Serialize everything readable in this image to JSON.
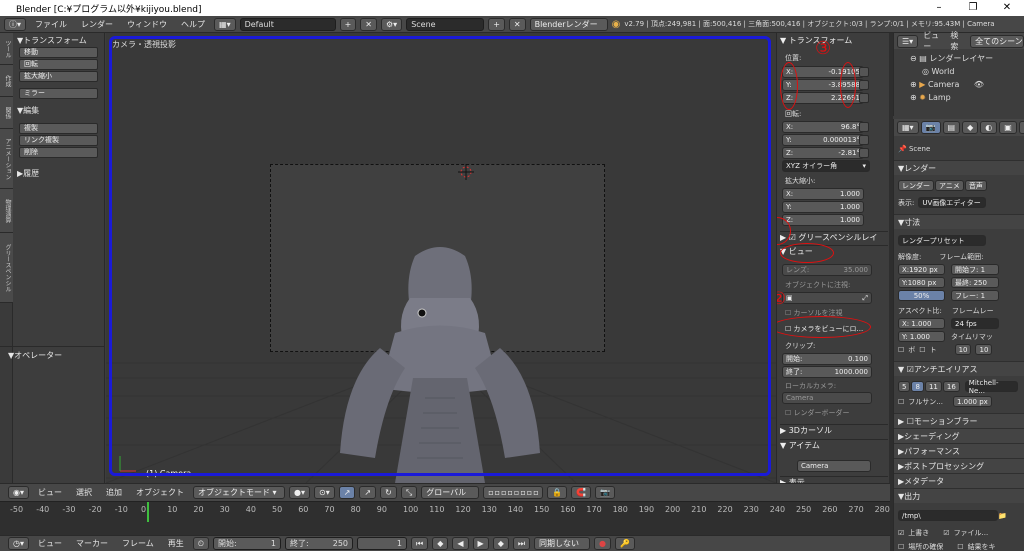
{
  "window": {
    "title": "Blender [C:¥プログラム以外¥kijiyou.blend]"
  },
  "info": {
    "menu": [
      "ファイル",
      "レンダー",
      "ウィンドウ",
      "ヘルプ"
    ],
    "layout": "Default",
    "scene": "Scene",
    "engine": "Blenderレンダー",
    "stats": "v2.79 | 頂点:249,981 | 面:500,416 | 三角面:500,416 | オブジェクト:0/3 | ランプ:0/1 | メモリ:95.43M | Camera"
  },
  "tabs": [
    "ツール",
    "作成",
    "関係",
    "アニメーション",
    "物理演算",
    "グリースペンシル"
  ],
  "toolshelf": {
    "transform_title": "トランスフォーム",
    "transform_buttons": [
      "移動",
      "回転",
      "拡大縮小"
    ],
    "mirror": "ミラー",
    "edit_title": "編集",
    "edit_buttons": [
      "複製",
      "リンク複製",
      "削除"
    ],
    "history": "履歴",
    "operator": "オペレーター"
  },
  "viewport": {
    "view_label": "カメラ・透視投影",
    "object_label": "(1) Camera"
  },
  "npanel": {
    "transform": "トランスフォーム",
    "location_label": "位置:",
    "location": [
      {
        "axis": "X:",
        "value": "-0.19105"
      },
      {
        "axis": "Y:",
        "value": "-3.89588"
      },
      {
        "axis": "Z:",
        "value": "2.22691"
      }
    ],
    "rotation_label": "回転:",
    "rotation": [
      {
        "axis": "X:",
        "value": "96.8°"
      },
      {
        "axis": "Y:",
        "value": "0.000013°"
      },
      {
        "axis": "Z:",
        "value": "-2.81°"
      }
    ],
    "rotation_mode": "XYZ オイラー角",
    "scale_label": "拡大縮小:",
    "scale": [
      {
        "axis": "X:",
        "value": "1.000"
      },
      {
        "axis": "Y:",
        "value": "1.000"
      },
      {
        "axis": "Z:",
        "value": "1.000"
      }
    ],
    "grease": "グリースペンシルレイ",
    "view": "ビュー",
    "lens_label": "レンズ:",
    "lens": "35.000",
    "lock_to_object": "オブジェクトに注視:",
    "lock_cursor": "カーソルを注視",
    "lock_camera": "カメラをビューにロ...",
    "clip": "クリップ:",
    "clip_start_label": "開始:",
    "clip_start": "0.100",
    "clip_end_label": "終了:",
    "clip_end": "1000.000",
    "local_camera": "ローカルカメラ:",
    "camera_field": "Camera",
    "render_border": "レンダーボーダー",
    "cursor3d": "3Dカーソル",
    "item": "アイテム",
    "item_name": "Camera",
    "next": "表示",
    "annot": [
      "③",
      "②",
      "①"
    ]
  },
  "outliner": {
    "view": "ビュー",
    "search": "検索",
    "all_scenes": "全てのシーン",
    "items": [
      "レンダーレイヤー",
      "World",
      "Camera",
      "Lamp"
    ]
  },
  "properties": {
    "scene": "Scene",
    "render": "レンダー",
    "render_btns": [
      "レンダー",
      "アニメ",
      "音声"
    ],
    "display_label": "表示:",
    "display": "UV画像エディター",
    "dimensions": "寸法",
    "preset": "レンダープリセット",
    "resolution": "解像度:",
    "res_x": "X:1920 px",
    "res_y": "Y:1080 px",
    "res_pct": "50%",
    "frame_range": "フレーム範囲:",
    "frame_start": "開始フ: 1",
    "frame_end": "最終: 250",
    "frame_step": "フレー: 1",
    "aspect": "アスペクト比:",
    "asp_x": "X: 1.000",
    "asp_y": "Y: 1.000",
    "frame_rate": "フレームレー",
    "fps": "24 fps",
    "remap": "タイムリマッ",
    "border": "ボ",
    "crop": "ト",
    "remap_old": "10",
    "remap_new": "10",
    "aa": "アンチエイリアス",
    "aa_samples": [
      "5",
      "8",
      "11",
      "16"
    ],
    "aa_filter": "Mitchell-Ne...",
    "full_sample": "フルサン...",
    "filter_size": "1.000 px",
    "sections": [
      "モーションブラー",
      "シェーディング",
      "パフォーマンス",
      "ポストプロセッシング",
      "メタデータ",
      "出力"
    ],
    "output_path": "/tmp\\",
    "overwrite": "上書き",
    "file_ext": "ファイル...",
    "placeholders": "場所の確保",
    "cache": "結果をキ"
  },
  "view3d_header": {
    "menus": [
      "ビュー",
      "選択",
      "追加",
      "オブジェクト"
    ],
    "mode": "オブジェクトモード",
    "pivot": "グローバル"
  },
  "timeline": {
    "ticks": [
      "-50",
      "-40",
      "-30",
      "-20",
      "-10",
      "0",
      "10",
      "20",
      "30",
      "40",
      "50",
      "60",
      "70",
      "80",
      "90",
      "100",
      "110",
      "120",
      "130",
      "140",
      "150",
      "160",
      "170",
      "180",
      "190",
      "200",
      "210",
      "220",
      "230",
      "240",
      "250",
      "260",
      "270",
      "280"
    ],
    "current_frame": 0,
    "menus": [
      "ビュー",
      "マーカー",
      "フレーム",
      "再生"
    ],
    "start_label": "開始:",
    "start": "1",
    "end_label": "終了:",
    "end": "250",
    "current": "1",
    "sync": "同期しない"
  }
}
